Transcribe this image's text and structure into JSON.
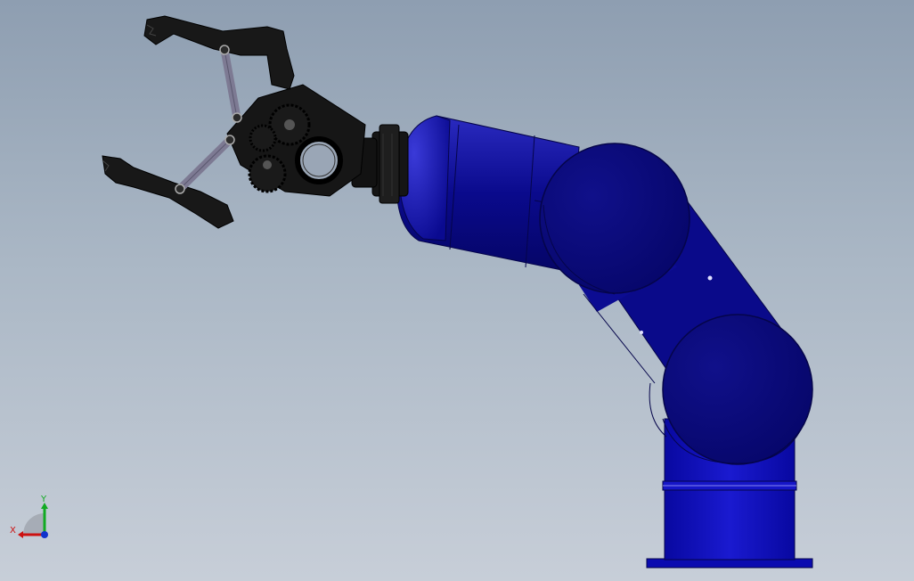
{
  "viewport": {
    "background_top": "#8e9eb1",
    "background_bottom": "#c7ced8"
  },
  "model": {
    "arm_color": "#0a0a8c",
    "arm_highlight": "#2a2ac0",
    "gripper_color": "#141414",
    "link_color": "#7d7a93"
  },
  "triad": {
    "x_label": "X",
    "y_label": "Y",
    "x_color": "#cc1111",
    "y_color": "#11aa22",
    "z_color": "#1133cc"
  }
}
